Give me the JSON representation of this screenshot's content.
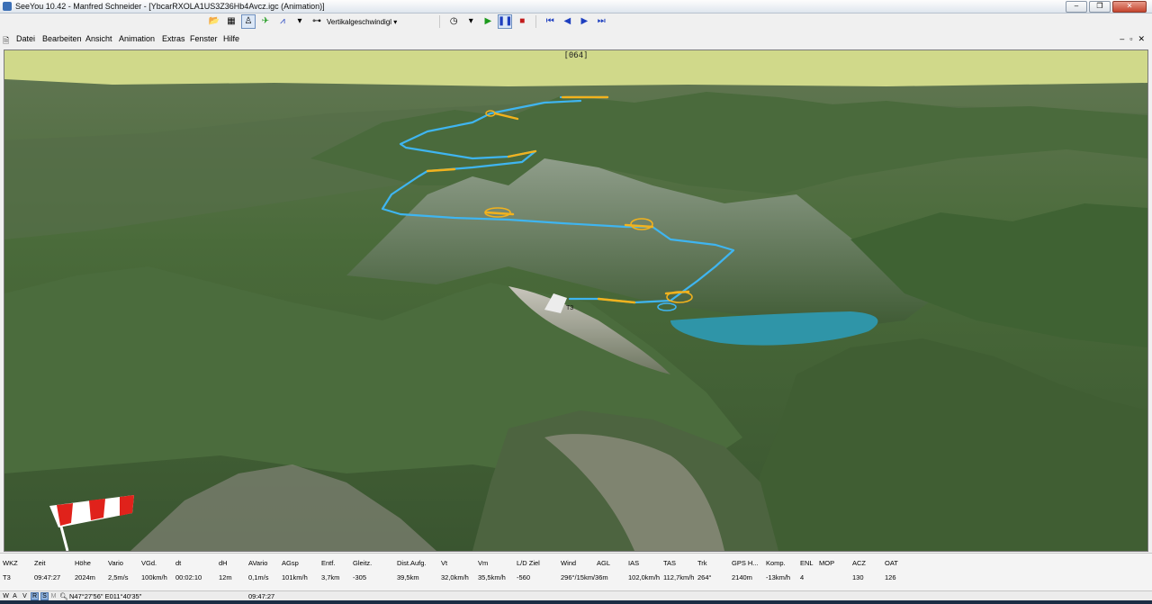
{
  "window": {
    "title": "SeeYou 10.42 - Manfred Schneider - [YbcarRXOLA1US3Z36Hb4Avcz.igc (Animation)]",
    "controls": [
      "–",
      "❐",
      "✕"
    ]
  },
  "toolbar": {
    "dropdown_label": "Vertikalgeschwindigl",
    "icons": [
      "folder-open-icon",
      "save-icon",
      "pilot-icon",
      "flight-icon",
      "graph-icon",
      "terrain-icon",
      "clock-icon",
      "play-icon",
      "pause-icon",
      "stop-icon",
      "step-back-icon",
      "rewind-icon",
      "step-forward-icon",
      "fast-forward-icon"
    ]
  },
  "menu": {
    "items": [
      "Datei",
      "Bearbeiten",
      "Ansicht",
      "Animation",
      "Extras",
      "Fenster",
      "Hilfe"
    ],
    "mdi_controls": [
      "‒",
      "▫",
      "✕"
    ]
  },
  "view": {
    "frame_label": "[064]",
    "turnpoint_label": "T3",
    "colors": {
      "sky": "#d0d98a",
      "track_primary": "#3fb5f0",
      "track_secondary": "#f2b21d",
      "lake": "#2f95a8"
    }
  },
  "data_panel": {
    "headers": [
      "WKZ",
      "Zeit",
      "Höhe",
      "Vario",
      "VGd.",
      "dt",
      "dH",
      "AVario",
      "AGsp",
      "Entf.",
      "Gleitz.",
      "Dist.Aufg.",
      "Vt",
      "Vm",
      "L/D Ziel",
      "Wind",
      "AGL",
      "IAS",
      "TAS",
      "Trk",
      "GPS H...",
      "Komp.",
      "ENL",
      "MOP",
      "ACZ",
      "OAT"
    ],
    "values": [
      "T3",
      "09:47:27",
      "2024m",
      "2,5m/s",
      "100km/h",
      "00:02:10",
      "12m",
      "0,1m/s",
      "101km/h",
      "3,7km",
      "-305",
      "39,5km",
      "32,0km/h",
      "35,5km/h",
      "-560",
      "296°/15km/36m",
      "",
      "102,0km/h",
      "112,7km/h",
      "264°",
      "2140m",
      "-13km/h",
      "4",
      "",
      "130",
      "126"
    ]
  },
  "status_bar": {
    "modes": [
      "W",
      "A",
      "V",
      "R",
      "S",
      "M"
    ],
    "coords": "N47°27'56\" E011°40'35\"",
    "time": "09:47:27"
  }
}
